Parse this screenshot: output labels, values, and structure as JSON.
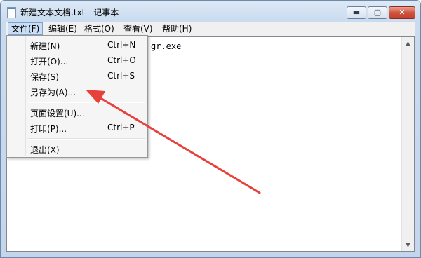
{
  "window": {
    "title": "新建文本文档.txt - 记事本",
    "buttons": {
      "minimize": "▬",
      "maximize": "▢",
      "close": "✕"
    }
  },
  "menubar": {
    "items": [
      {
        "label": "文件(F)",
        "active": true
      },
      {
        "label": "编辑(E)"
      },
      {
        "label": "格式(O)"
      },
      {
        "label": "查看(V)"
      },
      {
        "label": "帮助(H)"
      }
    ]
  },
  "editor": {
    "visible_text": "gr.exe"
  },
  "file_menu": {
    "items": [
      {
        "label": "新建(N)",
        "shortcut": "Ctrl+N"
      },
      {
        "label": "打开(O)...",
        "shortcut": "Ctrl+O"
      },
      {
        "label": "保存(S)",
        "shortcut": "Ctrl+S"
      },
      {
        "label": "另存为(A)...",
        "shortcut": ""
      },
      {
        "label": "页面设置(U)...",
        "shortcut": ""
      },
      {
        "label": "打印(P)...",
        "shortcut": "Ctrl+P"
      },
      {
        "label": "退出(X)",
        "shortcut": ""
      }
    ]
  },
  "annotation": {
    "arrow_color": "#e8403a",
    "points_to": "另存为(A)..."
  },
  "colors": {
    "menu_highlight": "#c9def5",
    "close_button": "#c9412b"
  }
}
